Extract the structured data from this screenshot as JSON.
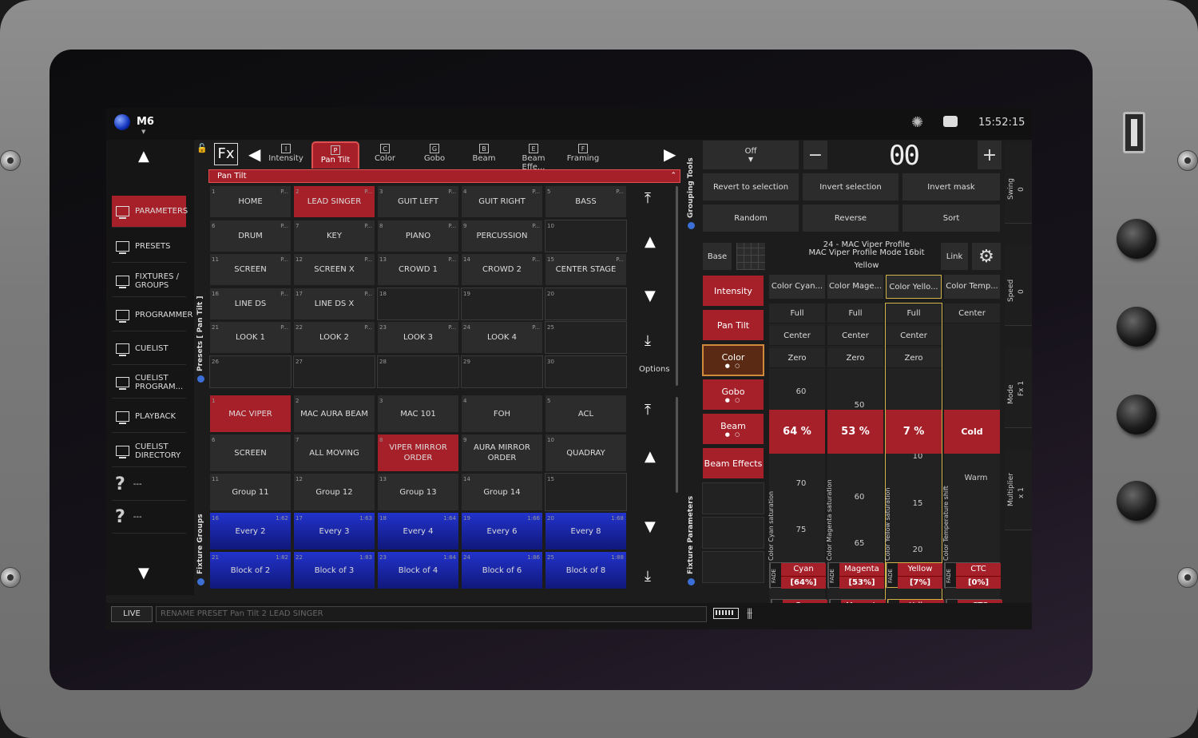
{
  "app": {
    "name": "M6",
    "clock": "15:52:15"
  },
  "nav": {
    "items": [
      {
        "label": "PARAMETERS",
        "active": true,
        "icon": "monitor-icon"
      },
      {
        "label": "PRESETS",
        "icon": "monitor-icon"
      },
      {
        "label": "FIXTURES / GROUPS",
        "icon": "monitor-icon"
      },
      {
        "label": "PROGRAMMER",
        "icon": "monitor-icon"
      },
      {
        "label": "CUELIST",
        "icon": "monitor-icon"
      },
      {
        "label": "CUELIST PROGRAM...",
        "icon": "monitor-icon"
      },
      {
        "label": "PLAYBACK",
        "icon": "monitor-icon"
      },
      {
        "label": "CUELIST DIRECTORY",
        "icon": "monitor-icon"
      },
      {
        "label": "---",
        "icon": "question-icon"
      },
      {
        "label": "---",
        "icon": "question-icon"
      }
    ]
  },
  "tabs": {
    "fx": "Fx",
    "items": [
      {
        "key": "I",
        "label": "Intensity"
      },
      {
        "key": "P",
        "label": "Pan Tilt",
        "active": true
      },
      {
        "key": "C",
        "label": "Color"
      },
      {
        "key": "G",
        "label": "Gobo"
      },
      {
        "key": "B",
        "label": "Beam"
      },
      {
        "key": "E",
        "label": "Beam Effe..."
      },
      {
        "key": "F",
        "label": "Framing"
      }
    ]
  },
  "presets": {
    "section_label": "Presets [ Pan Tilt ]",
    "bar_title": "Pan Tilt",
    "options_label": "Options",
    "cells": [
      {
        "n": "1",
        "label": "HOME",
        "p": "P..."
      },
      {
        "n": "2",
        "label": "LEAD SINGER",
        "p": "P...",
        "state": "red"
      },
      {
        "n": "3",
        "label": "GUIT LEFT",
        "p": "P..."
      },
      {
        "n": "4",
        "label": "GUIT RIGHT",
        "p": "P..."
      },
      {
        "n": "5",
        "label": "BASS",
        "p": "P..."
      },
      {
        "n": "6",
        "label": "DRUM",
        "p": "P..."
      },
      {
        "n": "7",
        "label": "KEY",
        "p": "P..."
      },
      {
        "n": "8",
        "label": "PIANO",
        "p": "P..."
      },
      {
        "n": "9",
        "label": "PERCUSSION",
        "p": "P..."
      },
      {
        "n": "10",
        "label": "",
        "state": "empty"
      },
      {
        "n": "11",
        "label": "SCREEN",
        "p": "P..."
      },
      {
        "n": "12",
        "label": "SCREEN X",
        "p": "P..."
      },
      {
        "n": "13",
        "label": "CROWD 1",
        "p": "P..."
      },
      {
        "n": "14",
        "label": "CROWD 2",
        "p": "P..."
      },
      {
        "n": "15",
        "label": "CENTER STAGE",
        "p": "P..."
      },
      {
        "n": "16",
        "label": "LINE DS",
        "p": "P..."
      },
      {
        "n": "17",
        "label": "LINE DS X",
        "p": "P..."
      },
      {
        "n": "18",
        "label": "",
        "state": "empty"
      },
      {
        "n": "19",
        "label": "",
        "state": "empty"
      },
      {
        "n": "20",
        "label": "",
        "state": "empty"
      },
      {
        "n": "21",
        "label": "LOOK 1",
        "p": "P..."
      },
      {
        "n": "22",
        "label": "LOOK 2",
        "p": "P..."
      },
      {
        "n": "23",
        "label": "LOOK 3",
        "p": "P..."
      },
      {
        "n": "24",
        "label": "LOOK 4",
        "p": "P..."
      },
      {
        "n": "25",
        "label": "",
        "state": "empty"
      },
      {
        "n": "26",
        "label": "",
        "state": "empty"
      },
      {
        "n": "27",
        "label": "",
        "state": "empty"
      },
      {
        "n": "28",
        "label": "",
        "state": "empty"
      },
      {
        "n": "29",
        "label": "",
        "state": "empty"
      },
      {
        "n": "30",
        "label": "",
        "state": "empty"
      }
    ]
  },
  "groups": {
    "section_label": "Fixture Groups",
    "cells": [
      {
        "n": "1",
        "label": "MAC VIPER",
        "state": "red"
      },
      {
        "n": "2",
        "label": "MAC AURA BEAM"
      },
      {
        "n": "3",
        "label": "MAC 101"
      },
      {
        "n": "4",
        "label": "FOH"
      },
      {
        "n": "5",
        "label": "ACL"
      },
      {
        "n": "6",
        "label": "SCREEN"
      },
      {
        "n": "7",
        "label": "ALL MOVING"
      },
      {
        "n": "8",
        "label": "VIPER MIRROR ORDER",
        "state": "red"
      },
      {
        "n": "9",
        "label": "AURA MIRROR ORDER"
      },
      {
        "n": "10",
        "label": "QUADRAY"
      },
      {
        "n": "11",
        "label": "Group 11"
      },
      {
        "n": "12",
        "label": "Group 12"
      },
      {
        "n": "13",
        "label": "Group 13"
      },
      {
        "n": "14",
        "label": "Group 14"
      },
      {
        "n": "15",
        "label": "",
        "state": "empty"
      },
      {
        "n": "16",
        "label": "Every 2",
        "p": "1:62",
        "state": "blue"
      },
      {
        "n": "17",
        "label": "Every 3",
        "p": "1:63",
        "state": "blue"
      },
      {
        "n": "18",
        "label": "Every 4",
        "p": "1:64",
        "state": "blue"
      },
      {
        "n": "19",
        "label": "Every 6",
        "p": "1:66",
        "state": "blue"
      },
      {
        "n": "20",
        "label": "Every 8",
        "p": "1:68",
        "state": "blue"
      },
      {
        "n": "21",
        "label": "Block of 2",
        "p": "1:82",
        "state": "blue"
      },
      {
        "n": "22",
        "label": "Block of 3",
        "p": "1:83",
        "state": "blue"
      },
      {
        "n": "23",
        "label": "Block of 4",
        "p": "1:84",
        "state": "blue"
      },
      {
        "n": "24",
        "label": "Block of 6",
        "p": "1:86",
        "state": "blue"
      },
      {
        "n": "25",
        "label": "Block of 8",
        "p": "1:88",
        "state": "blue"
      }
    ]
  },
  "grouping_tools": {
    "section_label": "Grouping Tools",
    "off_label": "Off",
    "minus": "−",
    "plus": "+",
    "display": "00",
    "revert": "Revert to selection",
    "invert_sel": "Invert selection",
    "invert_mask": "Invert mask",
    "random": "Random",
    "reverse": "Reverse",
    "sort": "Sort"
  },
  "fixture": {
    "section_label": "Fixture Parameters",
    "base": "Base",
    "link": "Link",
    "line1": "24 - MAC Viper Profile",
    "line2": "MAC Viper Profile Mode 16bit",
    "line3": "Yellow"
  },
  "params": [
    {
      "label": "Intensity"
    },
    {
      "label": "Pan Tilt"
    },
    {
      "label": "Color",
      "sel": true,
      "dots": "● ○"
    },
    {
      "label": "Gobo",
      "dots": "● ○"
    },
    {
      "label": "Beam",
      "dots": "● ○"
    },
    {
      "label": "Beam Effects"
    }
  ],
  "faders": [
    {
      "header": "Color Cyan...",
      "presets": [
        "Full",
        "Center",
        "Zero"
      ],
      "ticks": [
        "60",
        "70",
        "75"
      ],
      "value": "64 %",
      "vlabel": "Color Cyan saturation",
      "chip_name": "Cyan",
      "chip_value": "[64%]",
      "fade": "FADE"
    },
    {
      "header": "Color Mage...",
      "presets": [
        "Full",
        "Center",
        "Zero"
      ],
      "ticks": [
        "50",
        "60",
        "65"
      ],
      "value": "53 %",
      "vlabel": "Color Magenta saturation",
      "chip_name": "Magenta",
      "chip_value": "[53%]",
      "fade": "FADE"
    },
    {
      "header": "Color Yello...",
      "presets": [
        "Full",
        "Center",
        "Zero"
      ],
      "ticks": [
        "10",
        "15",
        "20"
      ],
      "value": "7 %",
      "vlabel": "Color Yellow saturation",
      "chip_name": "Yellow",
      "chip_value": "[7%]",
      "fade": "FADE",
      "sel": true
    },
    {
      "header": "Color Temp...",
      "presets": [
        "Center"
      ],
      "ticks": [],
      "value": "Cold",
      "value2": "Warm",
      "vlabel": "Color Temperature shift",
      "chip_name": "CTC",
      "chip_value": "[0%]",
      "fade": "FADE"
    }
  ],
  "encoders": [
    {
      "name": "Swing",
      "value": "0"
    },
    {
      "name": "Speed",
      "value": "0"
    },
    {
      "name": "Mode",
      "value": "Fx 1"
    },
    {
      "name": "Multiplier",
      "value": "x 1"
    }
  ],
  "bottom": {
    "live": "LIVE",
    "command": "RENAME PRESET Pan Tilt 2 LEAD SINGER"
  },
  "colors": {
    "accent_red": "#a6202a",
    "blue": "#2233cc",
    "selection_gold": "#d0b44a"
  }
}
